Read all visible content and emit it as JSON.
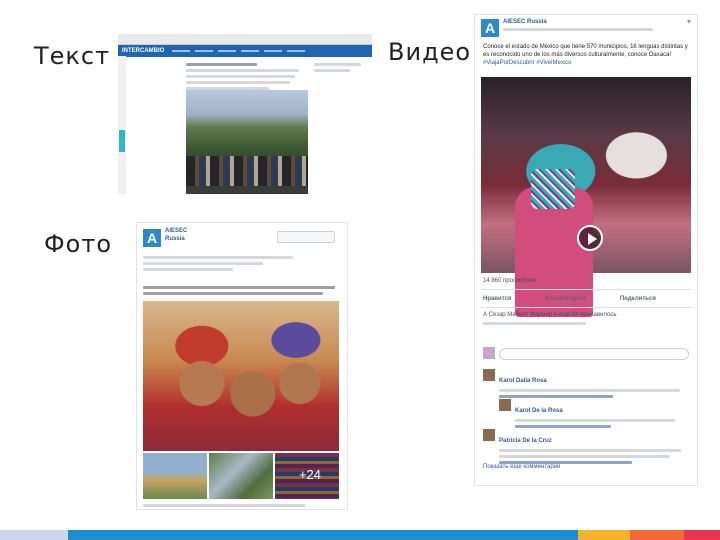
{
  "labels": {
    "text": "Текст",
    "video": "Видео",
    "photo": "Фото"
  },
  "text_screenshot": {
    "nav_brand": "INTERCAMBIO"
  },
  "photo_screenshot": {
    "page_name": "AIESEC",
    "page_name_2": "Russia",
    "more_count": "+24"
  },
  "video_screenshot": {
    "page_name": "AIESEC Russia",
    "post_text": "Conoce el estado de México que tiene 570 municipios, 16 lenguas distintas y es reconocido uno de los más diversos culturalmente, conoce Oaxaca!",
    "post_hashtags": "#ViajaPorDescubrir #VivelMexico",
    "views": "14 860 просмотров",
    "actions": [
      "Нравится",
      "Комментарий",
      "Поделиться"
    ],
    "likes_text": "А Сезар Мейнит Фармер и еще 64 понравилось",
    "comment_names": [
      "Karol Daila Rosa",
      "Karol De la Rosa",
      "Patricia De la Cruz"
    ],
    "show_more": "Показать еще комментарии"
  },
  "colors": {
    "stripe": [
      "#c9d6ec",
      "#1b8fd2",
      "#f7b32b",
      "#f26a36",
      "#e8364f"
    ],
    "brand_blue": "#2f88c9"
  }
}
